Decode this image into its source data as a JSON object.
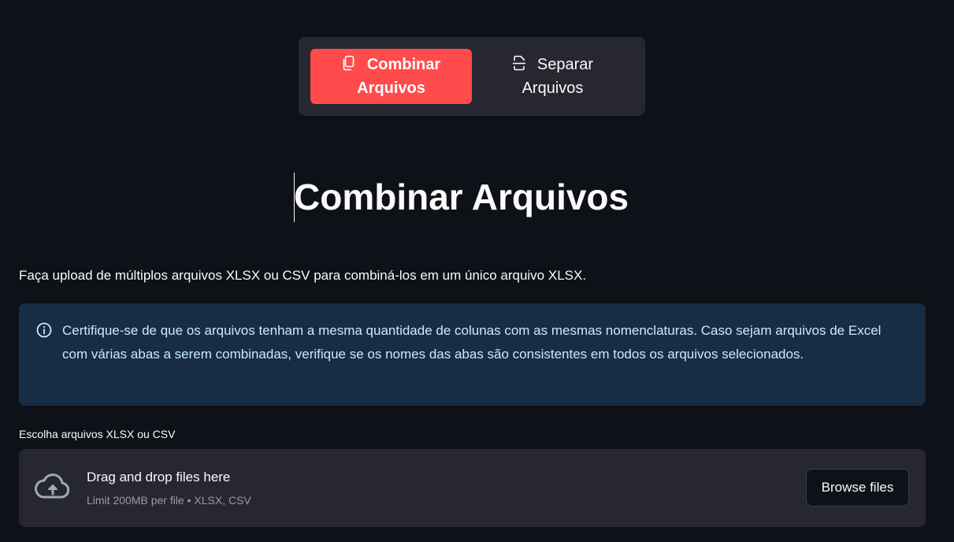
{
  "tabs": [
    {
      "label": "Combinar Arquivos",
      "icon": "copy-files-icon",
      "active": true
    },
    {
      "label": "Separar Arquivos",
      "icon": "file-split-icon",
      "active": false
    }
  ],
  "main": {
    "title": "Combinar Arquivos",
    "intro": "Faça upload de múltiplos arquivos XLSX ou CSV para combiná-los em um único arquivo XLSX.",
    "info": {
      "icon": "info-icon",
      "text": "Certifique-se de que os arquivos tenham a mesma quantidade de colunas com as mesmas nomenclaturas. Caso sejam arquivos de Excel com várias abas a serem combinadas, verifique se os nomes das abas são consistentes em todos os arquivos selecionados."
    }
  },
  "uploader": {
    "label": "Escolha arquivos XLSX ou CSV",
    "drop_title": "Drag and drop files here",
    "limit_text": "Limit 200MB per file • XLSX, CSV",
    "browse_label": "Browse files",
    "icon": "cloud-upload-icon"
  },
  "colors": {
    "background": "#0e1117",
    "accent": "#ff4b4b",
    "panel": "#262730",
    "info_bg": "#172d43",
    "info_text": "#c7ebff"
  }
}
